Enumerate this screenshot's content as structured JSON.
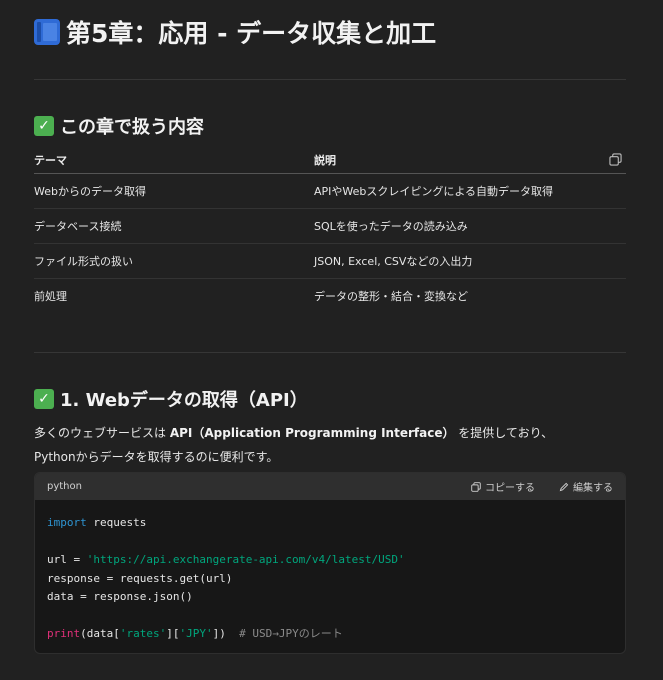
{
  "page": {
    "title": "第5章：応用 - データ収集と加工"
  },
  "section1": {
    "heading": "この章で扱う内容",
    "table": {
      "headers": [
        "テーマ",
        "説明"
      ],
      "rows": [
        [
          "Webからのデータ取得",
          "APIやWebスクレイピングによる自動データ取得"
        ],
        [
          "データベース接続",
          "SQLを使ったデータの読み込み"
        ],
        [
          "ファイル形式の扱い",
          "JSON, Excel, CSVなどの入出力"
        ],
        [
          "前処理",
          "データの整形・結合・変換など"
        ]
      ]
    }
  },
  "section2": {
    "heading": "1. Webデータの取得（API）",
    "para_pre": "多くのウェブサービスは ",
    "para_bold": "API（Application Programming Interface）",
    "para_post": " を提供しており、",
    "para_line2": "Pythonからデータを取得するのに便利です。"
  },
  "code": {
    "language": "python",
    "copy_label": "コピーする",
    "edit_label": "編集する",
    "kw_import": "import",
    "mod": " requests",
    "url_var": "url = ",
    "url_str": "'https://api.exchangerate-api.com/v4/latest/USD'",
    "line_response": "response = requests.get(url)",
    "line_data": "data = response.json()",
    "fn_print": "print",
    "print_a": "(data[",
    "print_s1": "'rates'",
    "print_b": "][",
    "print_s2": "'JPY'",
    "print_c": "])  ",
    "comment": "# USD→JPYのレート"
  },
  "icons": [
    "book-icon",
    "check-icon",
    "copy-icon",
    "edit-icon"
  ]
}
